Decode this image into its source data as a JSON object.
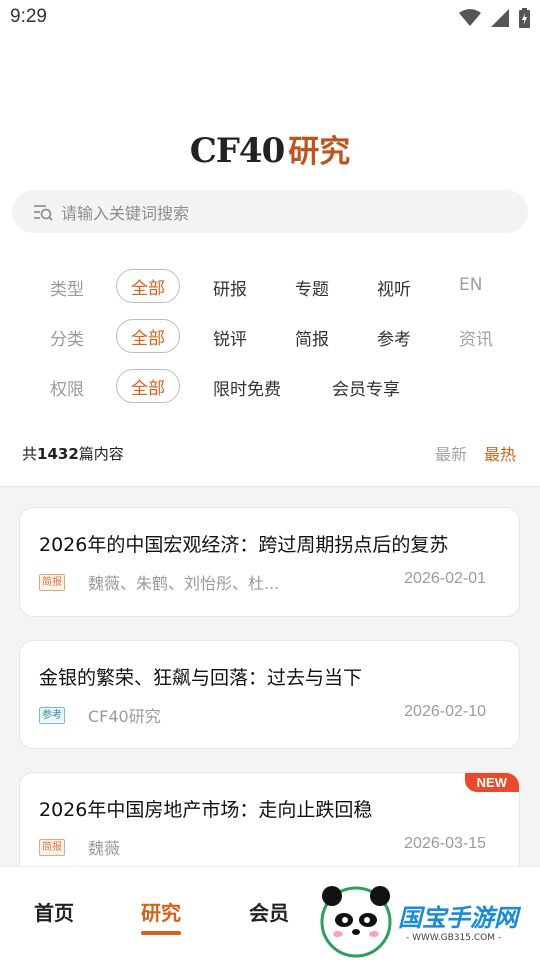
{
  "status_bar": {
    "time": "9:29"
  },
  "logo": {
    "en": "CF40",
    "cn": "研究"
  },
  "search": {
    "placeholder": "请输入关键词搜索"
  },
  "filters": {
    "type": {
      "label": "类型",
      "options": [
        "全部",
        "研报",
        "专题",
        "视听",
        "EN"
      ]
    },
    "category": {
      "label": "分类",
      "options": [
        "全部",
        "锐评",
        "简报",
        "参考",
        "资讯"
      ]
    },
    "access": {
      "label": "权限",
      "options": [
        "全部",
        "限时免费",
        "会员专享"
      ]
    }
  },
  "summary": {
    "prefix": "共",
    "count": "1432",
    "suffix": "篇内容"
  },
  "sort": {
    "latest": "最新",
    "hot": "最热",
    "active": "hot"
  },
  "articles": [
    {
      "title": "2026年的中国宏观经济：跨过周期拐点后的复苏",
      "tag": "简报",
      "authors": "魏薇、朱鹤、刘怡彤、杜...",
      "date": "2026-02-01"
    },
    {
      "title": "金银的繁荣、狂飙与回落：过去与当下",
      "tag": "参考",
      "authors": "CF40研究",
      "date": "2026-02-10"
    },
    {
      "title": "2026年中国房地产市场：走向止跌回稳",
      "tag": "简报",
      "authors": "魏薇",
      "date": "2026-03-15",
      "badge": "NEW"
    }
  ],
  "bottom_nav": {
    "items": [
      "首页",
      "研究",
      "会员"
    ],
    "active": "研究"
  },
  "watermark": {
    "text": "国宝手游网",
    "url": "- WWW.GB315.COM -"
  },
  "colors": {
    "accent": "#d4621b",
    "new_badge": "#e84a2c"
  }
}
